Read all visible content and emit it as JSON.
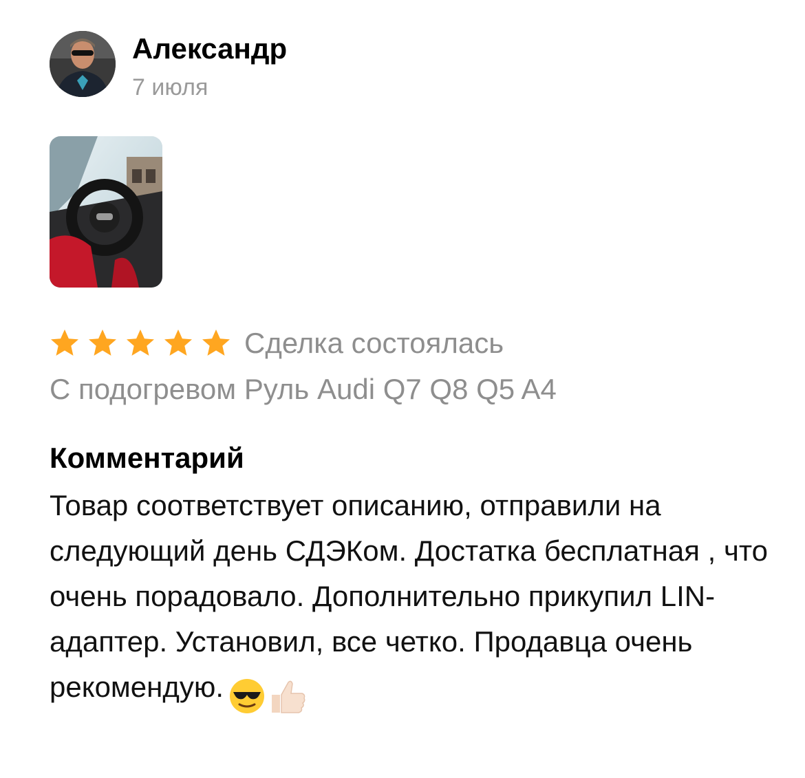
{
  "review": {
    "author": "Александр",
    "date": "7 июля",
    "rating": 5,
    "rating_max": 5,
    "deal_status": "Сделка состоялась",
    "product": "С подогревом Руль Audi Q7 Q8 Q5 A4",
    "comment_title": "Комментарий",
    "comment_text": "Товар соответствует описанию, отправили на следующий день СДЭКом. Достатка бесплатная , что очень порадовало. Дополнительно прикупил LIN-адаптер. Установил, все четко. Продавца очень рекомендую.",
    "emojis": [
      "sunglasses-face-emoji",
      "thumbs-up-emoji"
    ]
  },
  "colors": {
    "star": "#FFA620",
    "muted_text": "#8e8e8e",
    "date_text": "#9a9a9a"
  }
}
